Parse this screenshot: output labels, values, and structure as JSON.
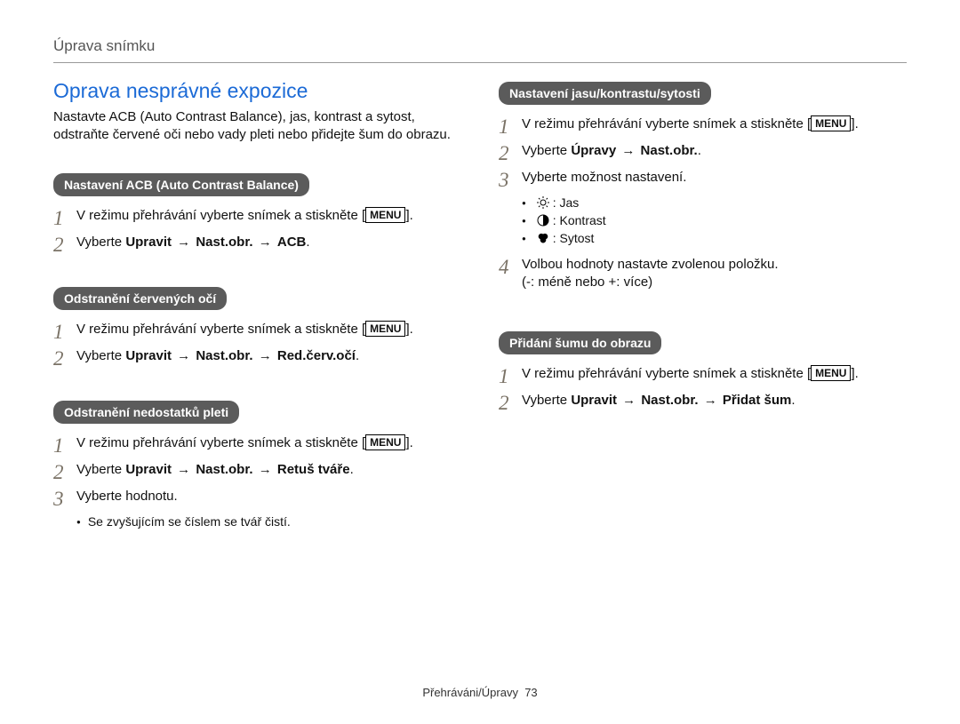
{
  "header": {
    "running_title": "Úprava snímku"
  },
  "left": {
    "title": "Oprava nesprávné expozice",
    "intro": "Nastavte ACB (Auto Contrast Balance), jas, kontrast a sytost, odstraňte červené oči nebo vady pleti nebo přidejte šum do obrazu.",
    "sec_acb": {
      "heading": "Nastavení ACB (Auto Contrast Balance)",
      "step1_a": "V režimu přehrávání vyberte snímek a stiskněte [",
      "step1_menu": "MENU",
      "step1_b": "].",
      "step2_a": "Vyberte ",
      "step2_b": "Upravit",
      "step2_c": "Nast.obr.",
      "step2_d": "ACB",
      "step2_e": "."
    },
    "sec_redeye": {
      "heading": "Odstranění červených očí",
      "step1_a": "V režimu přehrávání vyberte snímek a stiskněte [",
      "step1_menu": "MENU",
      "step1_b": "].",
      "step2_a": "Vyberte ",
      "step2_b": "Upravit",
      "step2_c": "Nast.obr.",
      "step2_d": "Red.červ.očí",
      "step2_e": "."
    },
    "sec_skin": {
      "heading": "Odstranění nedostatků pleti",
      "step1_a": "V režimu přehrávání vyberte snímek a stiskněte [",
      "step1_menu": "MENU",
      "step1_b": "].",
      "step2_a": "Vyberte ",
      "step2_b": "Upravit",
      "step2_c": "Nast.obr.",
      "step2_d": "Retuš tváře",
      "step2_e": ".",
      "step3": "Vyberte hodnotu.",
      "bullet1": "Se zvyšujícím se číslem se tvář čistí."
    }
  },
  "right": {
    "sec_bcs": {
      "heading": "Nastavení jasu/kontrastu/sytosti",
      "step1_a": "V režimu přehrávání vyberte snímek a stiskněte [",
      "step1_menu": "MENU",
      "step1_b": "].",
      "step2_a": "Vyberte ",
      "step2_b": "Úpravy",
      "step2_c": "Nast.obr.",
      "step2_d": ".",
      "step3": "Vyberte možnost nastavení.",
      "bullets": {
        "b1": ": Jas",
        "b2": ": Kontrast",
        "b3": ": Sytost"
      },
      "step4a": "Volbou hodnoty nastavte zvolenou položku.",
      "step4b": "(-: méně nebo +: více)"
    },
    "sec_noise": {
      "heading": "Přidání šumu do obrazu",
      "step1_a": "V režimu přehrávání vyberte snímek a stiskněte [",
      "step1_menu": "MENU",
      "step1_b": "].",
      "step2_a": "Vyberte ",
      "step2_b": "Upravit",
      "step2_c": "Nast.obr.",
      "step2_d": "Přidat šum",
      "step2_e": "."
    }
  },
  "footer": {
    "section": "Přehráváni/Úpravy",
    "page": "73"
  },
  "num": {
    "n1": "1",
    "n2": "2",
    "n3": "3",
    "n4": "4"
  },
  "glyph": {
    "arrow": "→"
  }
}
